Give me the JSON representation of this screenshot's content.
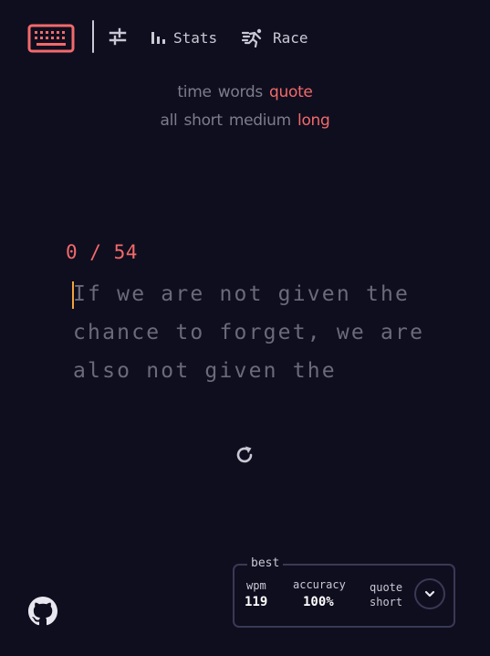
{
  "nav": {
    "stats_label": "Stats",
    "race_label": "Race"
  },
  "modes": {
    "type_options": [
      {
        "label": "time",
        "active": false
      },
      {
        "label": "words",
        "active": false
      },
      {
        "label": "quote",
        "active": true
      }
    ],
    "length_options": [
      {
        "label": "all",
        "active": false
      },
      {
        "label": "short",
        "active": false
      },
      {
        "label": "medium",
        "active": false
      },
      {
        "label": "long",
        "active": true
      }
    ]
  },
  "test": {
    "progress": "0 / 54",
    "quote_lines": [
      "If we are not given the",
      "chance to forget, we are",
      "also not given the"
    ]
  },
  "best": {
    "legend": "best",
    "wpm_label": "wpm",
    "wpm_value": "119",
    "accuracy_label": "accuracy",
    "accuracy_value": "100%",
    "mode_line1": "quote",
    "mode_line2": "short"
  },
  "colors": {
    "background": "#0f0e1f",
    "accent": "#f26a6a",
    "text_muted": "#6b6a7a",
    "text_light": "#c9c8d4",
    "caret": "#f2a33a",
    "border": "#3a3955"
  },
  "icons": {
    "logo": "keyboard-icon",
    "settings": "sliders-icon",
    "stats": "bar-chart-icon",
    "race": "running-person-icon",
    "restart": "restart-icon",
    "github": "github-icon",
    "expand": "chevron-down-icon"
  }
}
